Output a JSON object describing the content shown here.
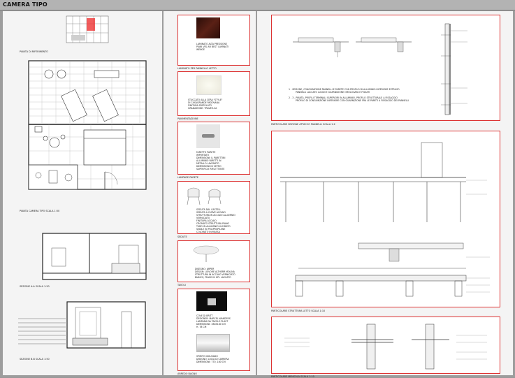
{
  "title": "CAMERA TIPO",
  "left": {
    "keyplan_label": "PIANTA DI RIFERIMENTO",
    "plan_label": "PIANTA CAMERA TIPO    SCALA 1:50",
    "section_aa_label": "SEZIONE A-A    SCALA 1:50",
    "section_bb_label": "SEZIONE B-B    SCALA 1:50"
  },
  "materials": [
    {
      "caption": "LAMINATO ALTA PRESSIONE\nPIANI VISI AR BEST LAMINATI\nWENGE",
      "section": "LAMINATO PER PANNELLO LETTO"
    },
    {
      "caption": "STUCCATO ALLA CERA \"STYLE\"\nDI CASAGRANDE PADOVANA\nFINITURA SPATOLATO\nGRADAZIONE: TRAVER-CA",
      "section": "PAVIMENTAZIONE"
    },
    {
      "caption": "FARETTO PARETE\nIMPORTATO\nDIMENSIONI: IL PARETTINI\nALLUMINIO FARETTI IN\nMETALLO LAVORATO\nDIMENSIONI DI VETRO\nSUPERFICIE RIFLETTENTE",
      "section": "LAMPADE PARETE"
    },
    {
      "caption": "SEDUTA DAL CASTELL\nSEDUTA A CURVE ACCIAIO\nSTRUTTURA IN ACCIAIO ALLUMINIO\nVERNICIATO\nFINITURA ACCIAIO\nCROMATO STRUTTURA PIANO\nTUBO IN ALLUMINIO LUCIDATO\nSEDILE IN POLIPROPILENE\nCOLORATO IN MASSA",
      "section": "SEDUTE"
    },
    {
      "caption": "DISEGNO: ARPER\nDESIGN: LIEVORE ALTHERR MOLINA\nSTRUTTURA IN ACCIAIO VERNICIATO\nBIANCO, PIANO IN HPL LACCATO",
      "section": "TAVOLI"
    },
    {
      "caption": "COVE DI BRITT\nDESIGNER: MARCEL WANDERS\nLAMPADA DA TAVOLO PLAST\nDIMENSIONI: 380X180 CM\nH. 78 CM",
      "section": ""
    },
    {
      "caption": "SPIRITO INGUSADO\nDISEGNO: LUCIA DI CARRERA\nDIMENSIONI: 770, 180 CM",
      "section": "ARREDO BAGNO"
    }
  ],
  "details": [
    {
      "label": "PARTICOLARE SEZIONE ATTACCO PANNELLI    SCALA 1:2",
      "notes": [
        "1 - SEZIONE, CONGIUNZIONE PANNELLI E PARETE CON PROFILO DI ALLUMINIO INFERIORE ESTRUSO",
        "PANNELLI LACCATO LUCIDI E GUARNIZIONE OMOLOGATA E FISSATI",
        "2 - 3 - PIANTA, PROFILI TERMINALI SUPERIORI IN ALLUMINIO, PROFILO STRUTTURALE A FISSAGGIO",
        "PROFILO DI CONGIUNZIONE INFERIORE CON GUARNIZIONE FRA LE PARETI A FISSAGGIO DEI PANNELLI"
      ]
    },
    {
      "label": "PARTICOLARE STRUTTURA LETTO    SCALA 1:10"
    },
    {
      "label": "PARTICOLARE MENSOLA    SCALA 1:10"
    }
  ]
}
